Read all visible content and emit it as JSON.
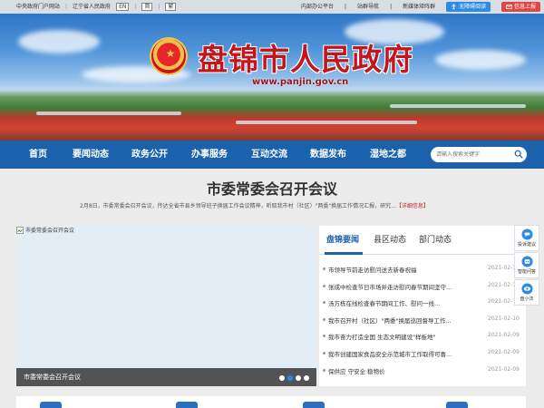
{
  "topbar": {
    "central_portal": "中央政府门户网站",
    "province_portal": "辽宁省人民政府",
    "lang_en": "EN",
    "lang_simplified": "简",
    "lang_traditional": "繁",
    "intranet": "内部办公平台",
    "site_nav": "站群导航",
    "new_media": "新媒体矩阵群",
    "accessible": "无障碍阅读",
    "letter": "信息上报"
  },
  "banner": {
    "title": "盘锦市人民政府",
    "url": "www.panjin.gov.cn"
  },
  "nav": {
    "items": [
      "首页",
      "要闻动态",
      "政务公开",
      "办事服务",
      "互动交流",
      "数据发布",
      "湿地之都"
    ],
    "search_placeholder": "请输入搜索关键字"
  },
  "headline": {
    "title": "市委常委会召开会议",
    "summary": "2月8日，市委常委会召开会议，传达全省市县乡领导班子换届工作会议精神，听取我市村（社区）\"两委\"换届工作情况汇报，研究...",
    "more": "【详细信息】"
  },
  "slide": {
    "alt_text": "市委常委会召开会议",
    "caption": "市委常委会召开会议",
    "dot_count": 4,
    "active_dot": 1
  },
  "news": {
    "tabs": [
      "盘锦要闻",
      "县区动态",
      "部门动态"
    ],
    "items": [
      {
        "title": "市领导节前走访慰问送去新春祝福",
        "date": "2021-02-10"
      },
      {
        "title": "张成中检查节日市场并走访慰问春节期间坚守...",
        "date": "2021-02-10"
      },
      {
        "title": "汤方栋在线检查春节期间工作、慰问一线...",
        "date": "2021-02-10"
      },
      {
        "title": "我市召开村（社区）\"两委\"换届巡回督导工作...",
        "date": "2021-02-10"
      },
      {
        "title": "我市奋力打造全国 生态文明建设\"样板地\"",
        "date": "2021-02-09"
      },
      {
        "title": "我市创建国家食品安全示范城市工作取得可喜...",
        "date": "2021-02-09"
      },
      {
        "title": "保供应 守安全 稳物价",
        "date": "2021-02-09"
      }
    ]
  },
  "float": {
    "items": [
      "投诉建议",
      "智能问答",
      "盘小法"
    ]
  },
  "colors": {
    "nav_blue": "#1b62ad",
    "title_red": "#c3161c",
    "accent_red": "#c81e1e"
  }
}
